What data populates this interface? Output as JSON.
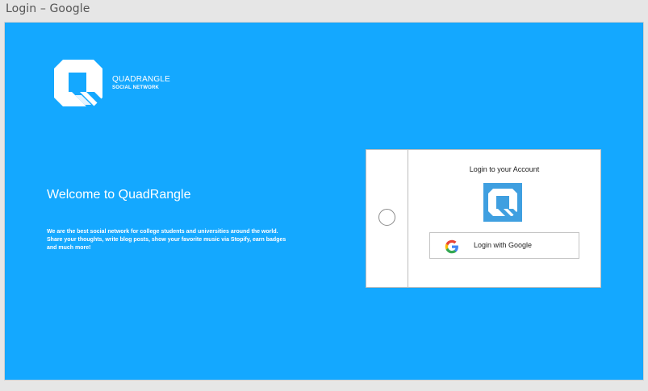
{
  "window": {
    "title": "Login – Google"
  },
  "brand": {
    "name": "QUADRANGLE",
    "tagline": "SOCIAL NETWORK",
    "logo_icon": "quadrangle-q-logo",
    "background_color": "#14a8ff"
  },
  "welcome": {
    "title": "Welcome to QuadRangle",
    "body": "We are the best social network for college students and universities around the world. Share your thoughts, write blog posts, show your favorite music via Stopify, earn badges and much more!"
  },
  "login_card": {
    "title": "Login to your Account",
    "logo_icon": "quadrangle-q-logo",
    "logo_color": "#3f9fe0",
    "google_button": {
      "label": "Login with Google",
      "icon": "google-icon"
    },
    "radio_state": "unselected"
  }
}
